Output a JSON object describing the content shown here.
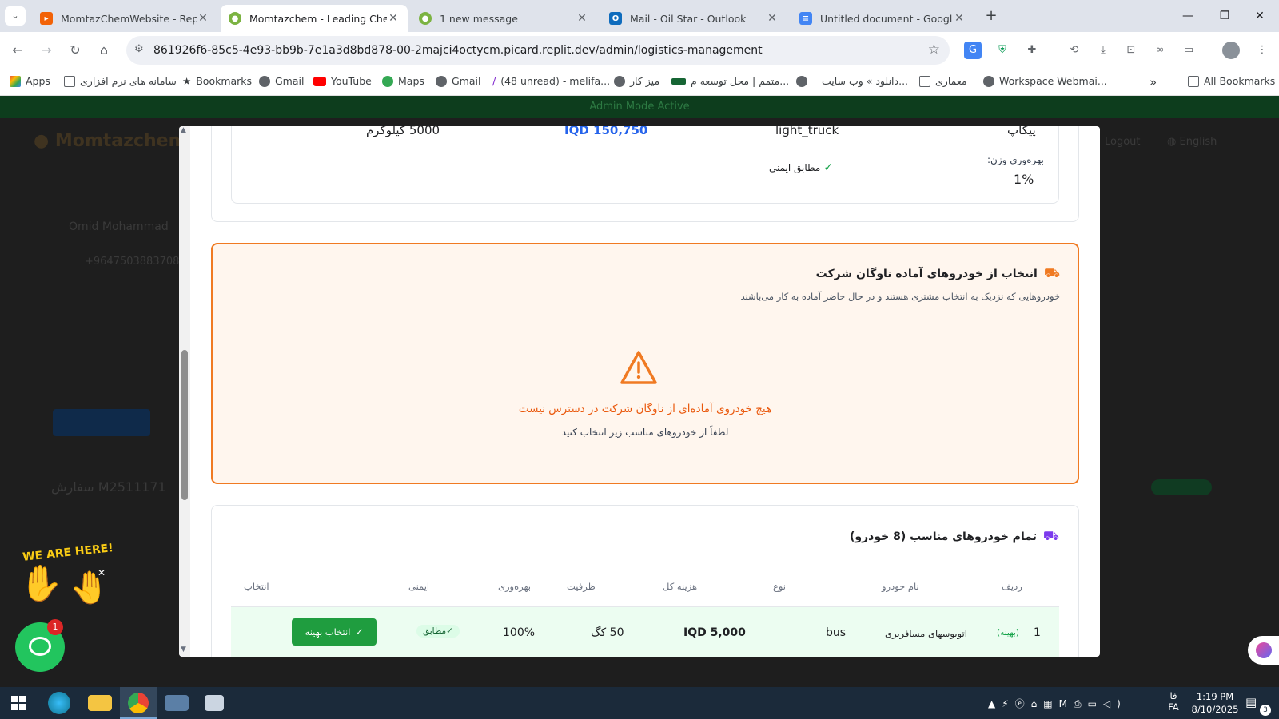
{
  "browser": {
    "tabs": [
      {
        "title": "MomtazChemWebsite - Replit",
        "active": false
      },
      {
        "title": "Momtazchem - Leading Chemic",
        "active": true
      },
      {
        "title": "1 new message",
        "active": false
      },
      {
        "title": "Mail - Oil Star - Outlook",
        "active": false
      },
      {
        "title": "Untitled document - Google Do",
        "active": false
      }
    ],
    "url": "861926f6-85c5-4e93-bb9b-7e1a3d8bd878-00-2majci4octycm.picard.replit.dev/admin/logistics-management",
    "bookmarks": [
      "Apps",
      "سامانه های نرم افزاری",
      "Bookmarks",
      "Gmail",
      "YouTube",
      "Maps",
      "Gmail",
      "(48 unread) - melifa...",
      "میز کار",
      "متمم | محل توسعه م...",
      "دانلود » وب سایت...",
      "معماری",
      "Workspace Webmai..."
    ],
    "all_bookmarks": "All Bookmarks"
  },
  "page": {
    "admin_banner": "Admin Mode Active",
    "brand": "Momtazchem",
    "logout": "Logout",
    "language": "English",
    "customer_name": "Omid Mohammad",
    "phone": "+9647503883708",
    "order_label": "سفارش M2511171"
  },
  "modal": {
    "top_card": {
      "weight": "5000 کیلوگرم",
      "cost": "IQD 150,750",
      "type": "light_truck",
      "vehicle": "پیکاپ",
      "safety": "مطابق ایمنی",
      "weight_efficiency_label": "بهره‌وری وزن:",
      "weight_efficiency_value": "1%"
    },
    "fleet_card": {
      "title": "انتخاب از خودروهای آماده ناوگان شرکت",
      "subtitle": "خودروهایی که نزدیک به انتخاب مشتری هستند و در حال حاضر آماده به کار می‌باشند",
      "warning": "هیچ خودروی آماده‌ای از ناوگان شرکت در دسترس نیست",
      "hint": "لطفاً از خودروهای مناسب زیر انتخاب کنید"
    },
    "all_card": {
      "title": "تمام خودروهای مناسب (8 خودرو)",
      "headers": [
        "ردیف",
        "نام خودرو",
        "نوع",
        "هزینه کل",
        "ظرفیت",
        "بهره‌وری",
        "ایمنی",
        "انتخاب"
      ],
      "row": {
        "index": "1",
        "best_tag": "(بهینه)",
        "name": "اتوبوسهای مسافربری",
        "type": "bus",
        "cost": "IQD 5,000",
        "capacity": "50 کگ",
        "efficiency": "100%",
        "safety": "مطابق",
        "select": "انتخاب بهینه"
      }
    }
  },
  "widget": {
    "we_are_here": "WE ARE HERE!",
    "chat_badge": "1"
  },
  "taskbar": {
    "lang": "FA",
    "lang_fa": "فا",
    "time": "1:19 PM",
    "date": "8/10/2025",
    "notif_count": "3"
  },
  "colors": {
    "orange": "#f07a22",
    "green": "#1f9d3f",
    "blue_cost": "#2563eb",
    "purple_icon": "#7c3aed"
  }
}
